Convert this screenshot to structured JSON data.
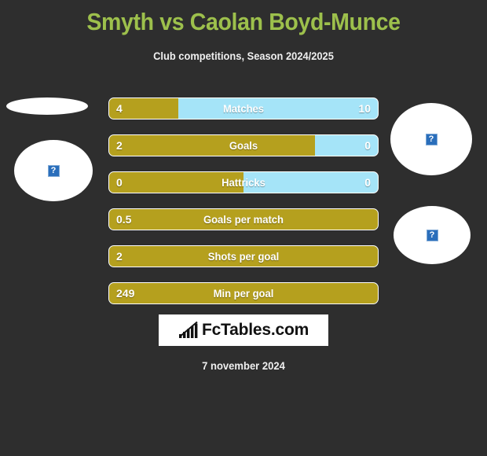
{
  "header": {
    "title": "Smyth vs Caolan Boyd-Munce",
    "subtitle": "Club competitions, Season 2024/2025",
    "title_color": "#9dc04c"
  },
  "colors": {
    "background": "#2e2e2e",
    "home_bar": "#b5a01e",
    "away_bar": "#a5e4f8",
    "text": "#ffffff"
  },
  "players": {
    "home": {
      "flag_icon": "flag-placeholder-icon",
      "photo_icon": "broken-image-icon",
      "photo_glyph": "?"
    },
    "away": {
      "photo_icon": "broken-image-icon",
      "photo_glyph": "?",
      "club_icon": "broken-image-icon",
      "club_glyph": "?"
    }
  },
  "stats": [
    {
      "label": "Matches",
      "home_value": "4",
      "away_value": "10",
      "home_percent": 25.6,
      "has_away": true
    },
    {
      "label": "Goals",
      "home_value": "2",
      "away_value": "0",
      "home_percent": 76.5,
      "has_away": true
    },
    {
      "label": "Hattricks",
      "home_value": "0",
      "away_value": "0",
      "home_percent": 50,
      "has_away": true
    },
    {
      "label": "Goals per match",
      "home_value": "0.5",
      "away_value": "",
      "home_percent": 100,
      "has_away": false
    },
    {
      "label": "Shots per goal",
      "home_value": "2",
      "away_value": "",
      "home_percent": 100,
      "has_away": false
    },
    {
      "label": "Min per goal",
      "home_value": "249",
      "away_value": "",
      "home_percent": 100,
      "has_away": false
    }
  ],
  "logo": {
    "text": "FcTables.com",
    "icon": "bar-chart-icon"
  },
  "footer": {
    "date": "7 november 2024"
  }
}
